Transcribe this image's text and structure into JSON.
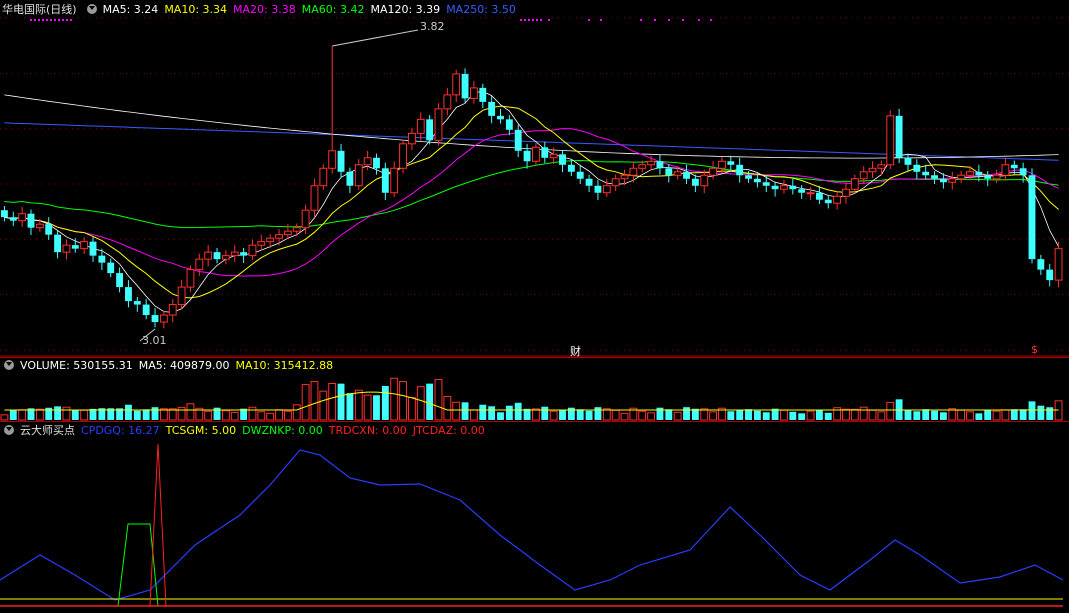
{
  "title": "华电国际(日线)",
  "ma": [
    {
      "label": "MA5: 3.24",
      "color": "#ffffff"
    },
    {
      "label": "MA10: 3.34",
      "color": "#ffff00"
    },
    {
      "label": "MA20: 3.38",
      "color": "#ff00ff"
    },
    {
      "label": "MA60: 3.42",
      "color": "#00ff00"
    },
    {
      "label": "MA120: 3.39",
      "color": "#ffffff"
    },
    {
      "label": "MA250: 3.50",
      "color": "#3a5cff"
    }
  ],
  "volume_legend": [
    {
      "label": "VOLUME: 530155.31",
      "color": "#ffffff"
    },
    {
      "label": "MA5: 409879.00",
      "color": "#ffffff"
    },
    {
      "label": "MA10: 315412.88",
      "color": "#ffff00"
    }
  ],
  "indicator_title": "云大师买点",
  "indicator_legend": [
    {
      "label": "CPDGQ: 16.27",
      "color": "#2a3cff"
    },
    {
      "label": "TCSGM: 5.00",
      "color": "#ffff00"
    },
    {
      "label": "DWZNKP: 0.00",
      "color": "#00ff00"
    },
    {
      "label": "TRDCXN: 0.00",
      "color": "#ff2020"
    },
    {
      "label": "JTCDAZ: 0.00",
      "color": "#ff2020"
    }
  ],
  "annotations": {
    "high": "3.82",
    "low": "3.01",
    "cai": "财",
    "dollar": "$"
  },
  "chart_data": {
    "type": "candlestick",
    "ylim": [
      2.95,
      3.9
    ],
    "high_price": 3.82,
    "low_price": 3.01,
    "close": [
      3.33,
      3.32,
      3.34,
      3.3,
      3.31,
      3.28,
      3.23,
      3.25,
      3.24,
      3.26,
      3.22,
      3.2,
      3.17,
      3.13,
      3.09,
      3.08,
      3.05,
      3.03,
      3.05,
      3.08,
      3.13,
      3.18,
      3.21,
      3.23,
      3.21,
      3.22,
      3.23,
      3.22,
      3.25,
      3.26,
      3.27,
      3.28,
      3.29,
      3.3,
      3.35,
      3.42,
      3.47,
      3.52,
      3.46,
      3.42,
      3.48,
      3.5,
      3.47,
      3.4,
      3.47,
      3.54,
      3.57,
      3.61,
      3.55,
      3.64,
      3.68,
      3.74,
      3.67,
      3.7,
      3.66,
      3.62,
      3.61,
      3.58,
      3.52,
      3.49,
      3.53,
      3.5,
      3.51,
      3.48,
      3.46,
      3.44,
      3.42,
      3.4,
      3.42,
      3.44,
      3.45,
      3.47,
      3.48,
      3.49,
      3.47,
      3.45,
      3.46,
      3.44,
      3.42,
      3.45,
      3.47,
      3.49,
      3.48,
      3.45,
      3.44,
      3.43,
      3.42,
      3.41,
      3.42,
      3.41,
      3.4,
      3.4,
      3.38,
      3.37,
      3.39,
      3.41,
      3.44,
      3.46,
      3.47,
      3.48,
      3.62,
      3.5,
      3.48,
      3.46,
      3.45,
      3.44,
      3.43,
      3.44,
      3.45,
      3.46,
      3.45,
      3.44,
      3.45,
      3.48,
      3.47,
      3.45,
      3.21,
      3.18,
      3.15,
      3.24
    ],
    "volume_ma": {
      "VOLUME": 530155.31,
      "MA5": 409879.0,
      "MA10": 315412.88
    }
  }
}
